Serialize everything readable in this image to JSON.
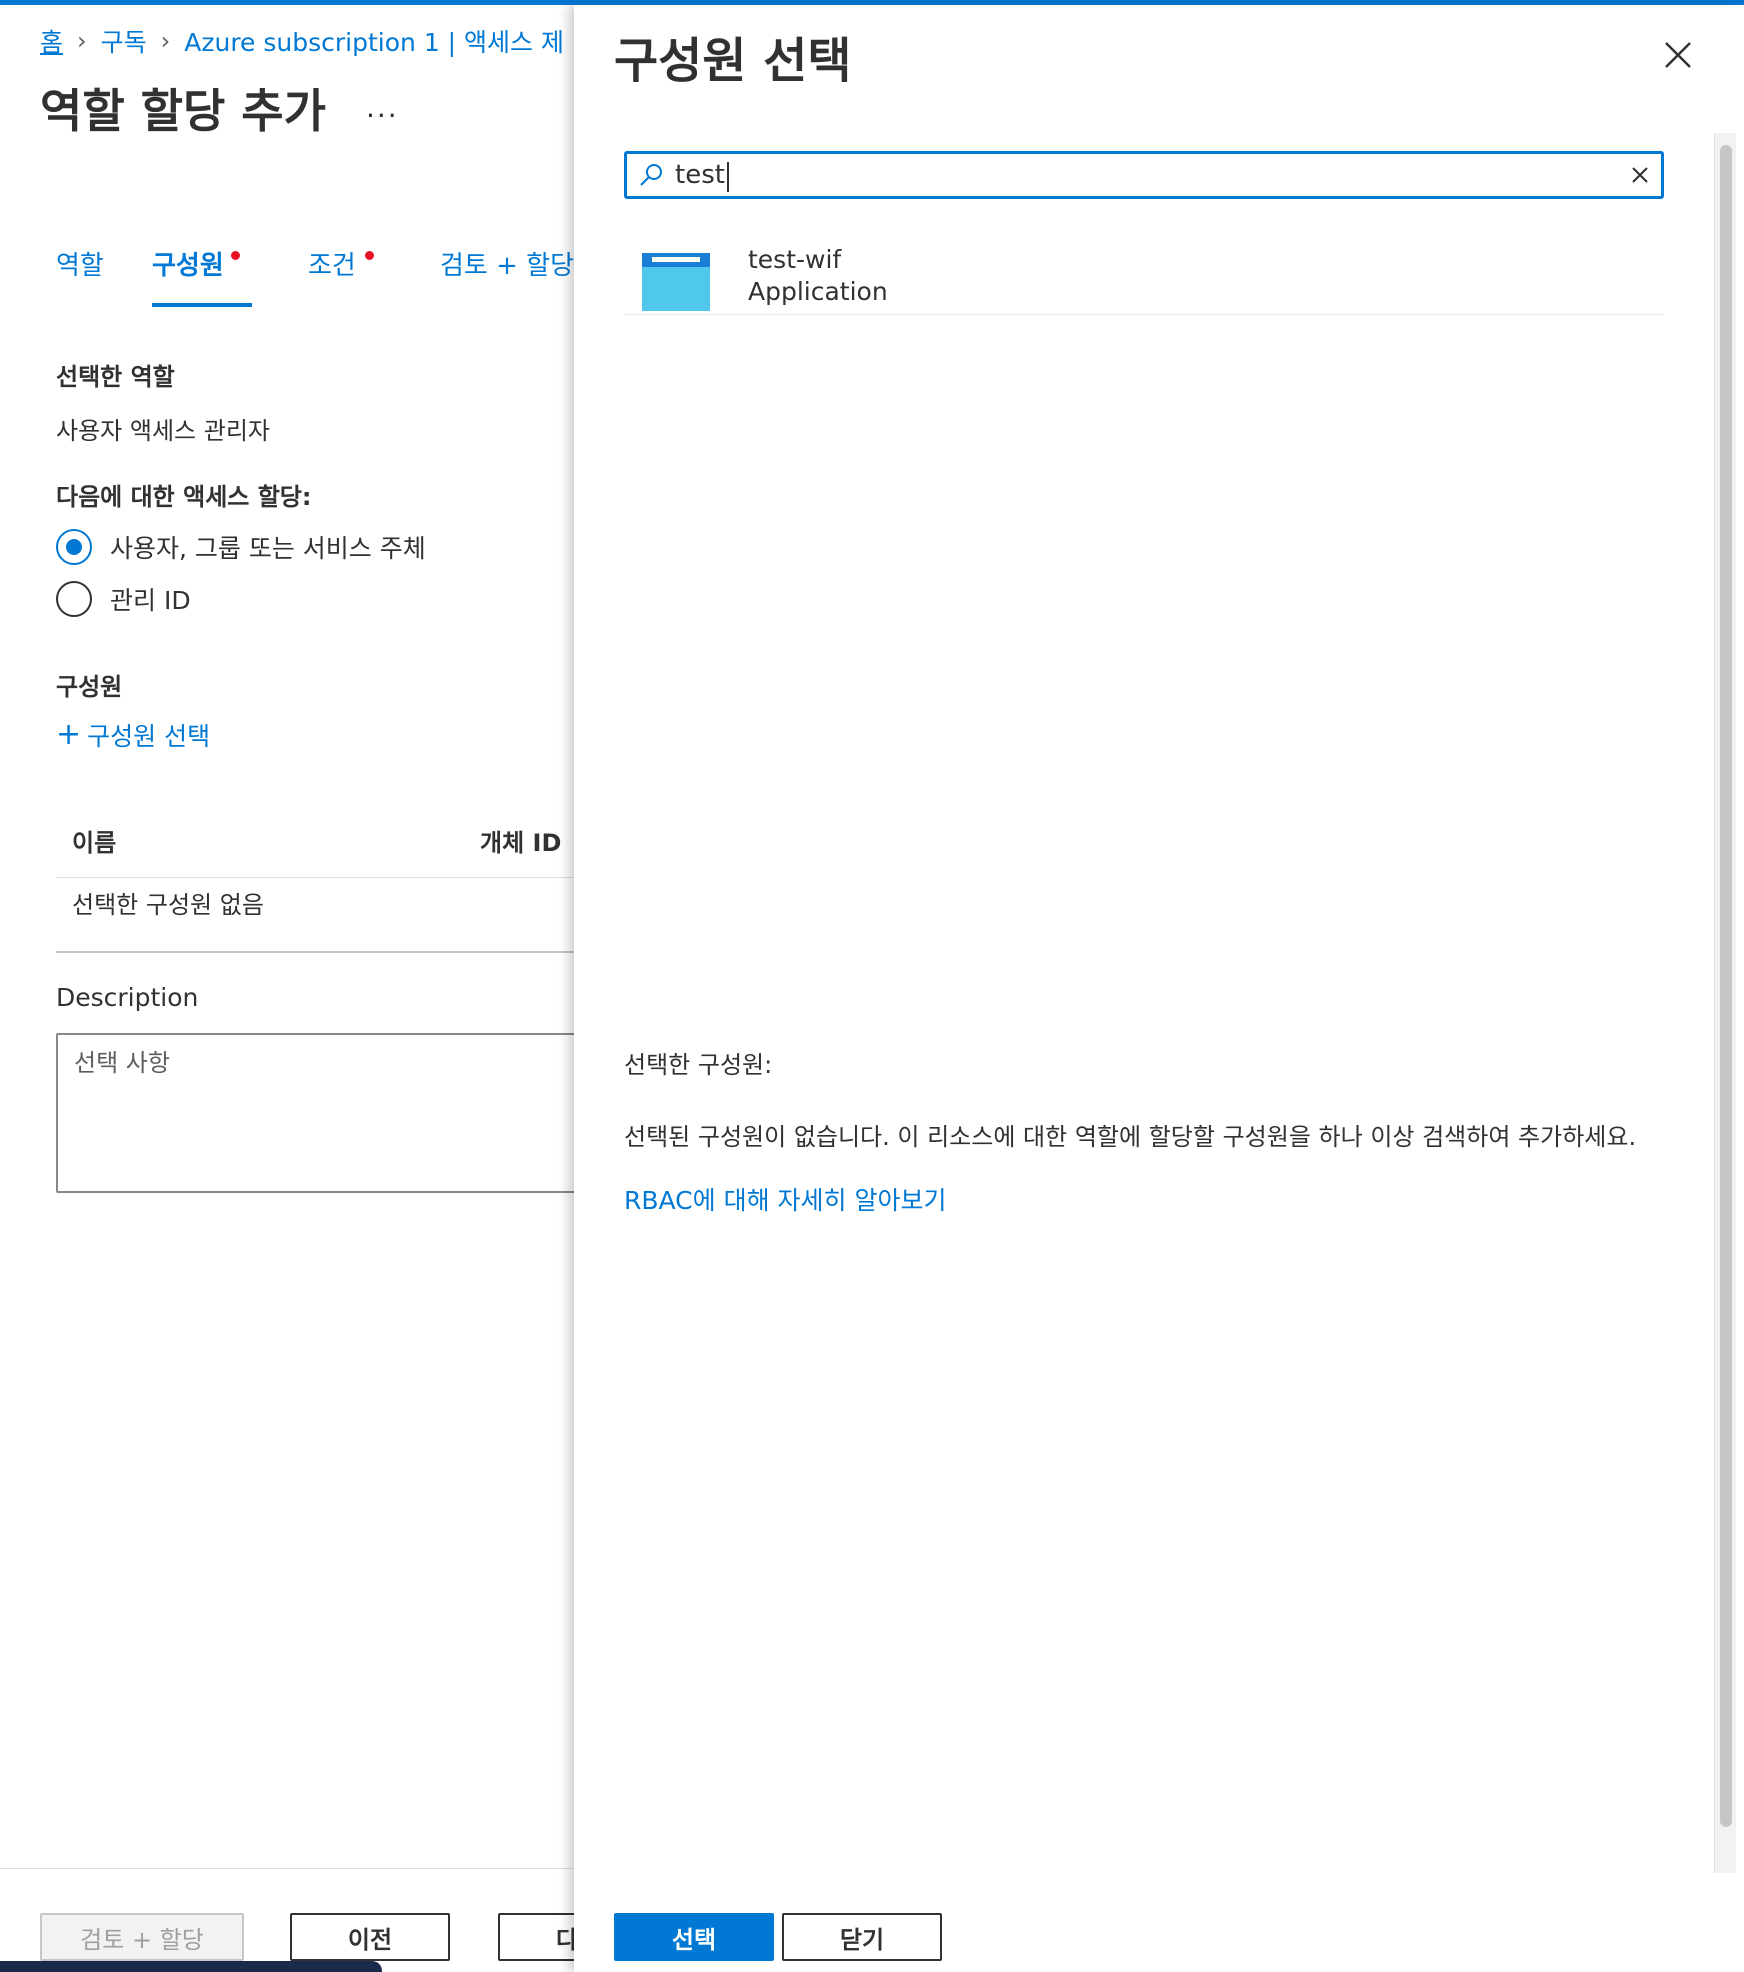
{
  "breadcrumb": {
    "home": "홈",
    "subscriptions": "구독",
    "current": "Azure subscription 1 | 액세스 제"
  },
  "page": {
    "title": "역할 할당 추가",
    "more": "..."
  },
  "tabs": [
    {
      "label": "역할",
      "required": false,
      "active": false
    },
    {
      "label": "구성원",
      "required": true,
      "active": true
    },
    {
      "label": "조건",
      "required": true,
      "active": false
    },
    {
      "label": "검토 + 할당",
      "required": false,
      "active": false
    }
  ],
  "selected_role": {
    "label": "선택한 역할",
    "value": "사용자 액세스 관리자"
  },
  "assign_access": {
    "label": "다음에 대한 액세스 할당:",
    "options": [
      {
        "label": "사용자, 그룹 또는 서비스 주체",
        "checked": true
      },
      {
        "label": "관리 ID",
        "checked": false
      }
    ]
  },
  "members": {
    "label": "구성원",
    "add_link": "구성원 선택",
    "columns": [
      "이름",
      "개체 ID"
    ],
    "empty_text": "선택한 구성원 없음"
  },
  "description": {
    "label": "Description",
    "placeholder": "선택 사항"
  },
  "footer": {
    "review_assign": "검토 + 할당",
    "previous": "이전",
    "next": "다"
  },
  "blade": {
    "title": "구성원 선택",
    "search_value": "test",
    "results": [
      {
        "name": "test-wif",
        "type": "Application"
      }
    ],
    "selected_label": "선택한 구성원:",
    "selected_message": "선택된 구성원이 없습니다. 이 리소스에 대한 역할에 할당할 구성원을 하나 이상 검색하여 추가하세요.",
    "rbac_link": "RBAC에 대해 자세히 알아보기",
    "select_button": "선택",
    "close_button": "닫기"
  },
  "colors": {
    "accent": "#0078d4",
    "required_dot": "#e81123",
    "text": "#323130"
  }
}
